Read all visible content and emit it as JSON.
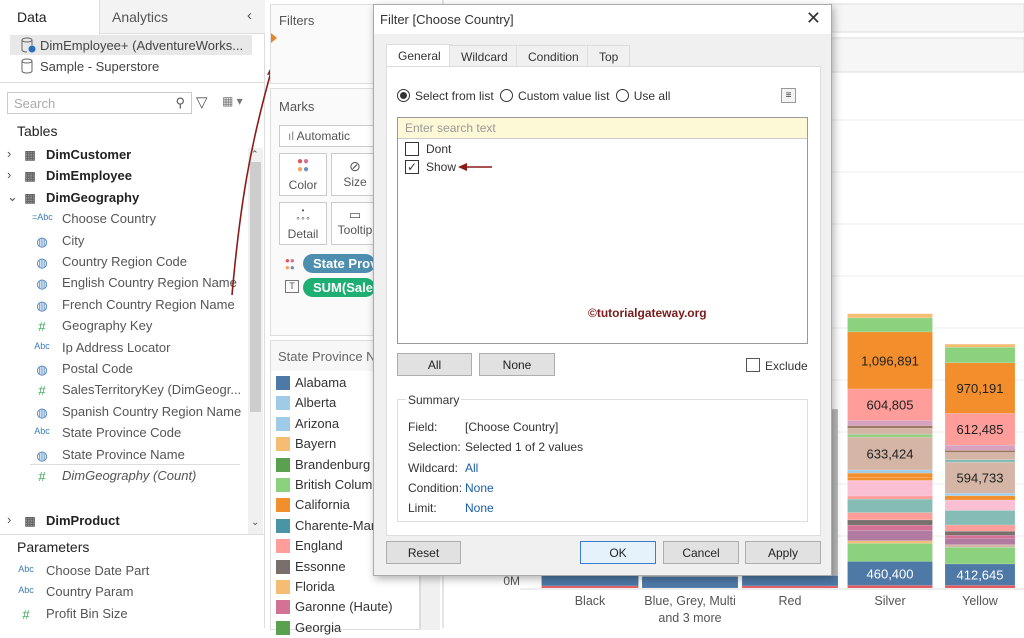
{
  "left_panel": {
    "tabs": [
      "Data",
      "Analytics"
    ],
    "data_sources": [
      "DimEmployee+ (AdventureWorks...",
      "Sample - Superstore"
    ],
    "search_placeholder": "Search",
    "tables_heading": "Tables",
    "tree": [
      {
        "type": "table",
        "label": "DimCustomer",
        "expanded": false
      },
      {
        "type": "table",
        "label": "DimEmployee",
        "expanded": false
      },
      {
        "type": "table",
        "label": "DimGeography",
        "expanded": true
      },
      {
        "type": "field",
        "icon": "=Abc",
        "label": "Choose Country"
      },
      {
        "type": "field",
        "icon": "globe",
        "label": "City"
      },
      {
        "type": "field",
        "icon": "globe",
        "label": "Country Region Code"
      },
      {
        "type": "field",
        "icon": "globe",
        "label": "English Country Region Name"
      },
      {
        "type": "field",
        "icon": "globe",
        "label": "French Country Region Name"
      },
      {
        "type": "field",
        "icon": "#",
        "label": "Geography Key"
      },
      {
        "type": "field",
        "icon": "Abc",
        "label": "Ip Address Locator"
      },
      {
        "type": "field",
        "icon": "globe",
        "label": "Postal Code"
      },
      {
        "type": "field",
        "icon": "#",
        "label": "SalesTerritoryKey (DimGeogr..."
      },
      {
        "type": "field",
        "icon": "globe",
        "label": "Spanish Country Region Name"
      },
      {
        "type": "field",
        "icon": "Abc",
        "label": "State Province Code"
      },
      {
        "type": "field",
        "icon": "globe",
        "label": "State Province Name"
      },
      {
        "type": "measure",
        "icon": "#",
        "label": "DimGeography (Count)"
      },
      {
        "type": "table",
        "label": "DimProduct",
        "expanded": false
      }
    ],
    "parameters_heading": "Parameters",
    "parameters": [
      {
        "icon": "Abc",
        "label": "Choose Date Part"
      },
      {
        "icon": "Abc",
        "label": "Country Param"
      },
      {
        "icon": "#",
        "label": "Profit Bin Size"
      }
    ]
  },
  "shelves": {
    "filters_title": "Filters",
    "marks_title": "Marks",
    "mark_type": "Automatic",
    "cards": [
      "Color",
      "Size",
      "Detail",
      "Tooltip"
    ],
    "pills": [
      {
        "label": "State Province Name",
        "color": "#4e8faf"
      },
      {
        "label": "SUM(Sales Amount)",
        "color": "#1fae74"
      }
    ]
  },
  "legend": {
    "title": "State Province Name",
    "items": [
      {
        "label": "Alabama",
        "color": "#4e79a7"
      },
      {
        "label": "Alberta",
        "color": "#a0cbe8"
      },
      {
        "label": "Arizona",
        "color": "#a0cbe8"
      },
      {
        "label": "Bayern",
        "color": "#f5bd74"
      },
      {
        "label": "Brandenburg",
        "color": "#59a14f"
      },
      {
        "label": "British Columbia",
        "color": "#8cd17d"
      },
      {
        "label": "California",
        "color": "#f28e2b"
      },
      {
        "label": "Charente-Maritime",
        "color": "#4a94a8"
      },
      {
        "label": "England",
        "color": "#ff9d9a"
      },
      {
        "label": "Essonne",
        "color": "#79706e"
      },
      {
        "label": "Florida",
        "color": "#f5bd74"
      },
      {
        "label": "Garonne (Haute)",
        "color": "#d37295"
      },
      {
        "label": "Georgia",
        "color": "#59a14f"
      }
    ]
  },
  "dialog": {
    "title": "Filter [Choose Country]",
    "tabs": [
      "General",
      "Wildcard",
      "Condition",
      "Top"
    ],
    "radio_options": [
      {
        "label": "Select from list",
        "selected": true
      },
      {
        "label": "Custom value list",
        "selected": false
      },
      {
        "label": "Use all",
        "selected": false
      }
    ],
    "search_placeholder": "Enter search text",
    "values": [
      {
        "label": "Dont",
        "checked": false
      },
      {
        "label": "Show",
        "checked": true
      }
    ],
    "watermark": "©tutorialgateway.org",
    "all_label": "All",
    "none_label": "None",
    "exclude_label": "Exclude",
    "summary": {
      "heading": "Summary",
      "rows": [
        {
          "label": "Field:",
          "value": "[Choose Country]"
        },
        {
          "label": "Selection:",
          "value": "Selected 1 of 2 values"
        },
        {
          "label": "Wildcard:",
          "value": "All"
        },
        {
          "label": "Condition:",
          "value": "None"
        },
        {
          "label": "Limit:",
          "value": "None"
        }
      ]
    },
    "buttons": {
      "reset": "Reset",
      "ok": "OK",
      "cancel": "Cancel",
      "apply": "Apply"
    }
  },
  "chart_data": {
    "type": "bar",
    "stacked": true,
    "categories": [
      "Black",
      "Blue, Grey, Multi and 3 more",
      "Red",
      "Silver",
      "Yellow"
    ],
    "y_tick_visible": "0M",
    "ylim": [
      0,
      5.3
    ],
    "series_labels": {
      "Silver": {
        "Alabama": "460,400",
        "Charente-Maritime": "633,424",
        "England": "604,805",
        "California": "1,096,891"
      },
      "Yellow": {
        "Alabama": "412,645",
        "Charente-Maritime": "594,733",
        "England": "612,485",
        "California": "970,191"
      }
    },
    "bars": [
      {
        "category": "Black",
        "segments": [
          [
            0.04,
            "#e15759"
          ],
          [
            0.2,
            "#4e79a7"
          ],
          [
            4.0,
            "#bbbbbb"
          ]
        ]
      },
      {
        "category": "Blue, Grey, Multi and 3 more",
        "segments": [
          [
            0.22,
            "#4e79a7"
          ],
          [
            3.5,
            "#bbbbbb"
          ]
        ]
      },
      {
        "category": "Red",
        "segments": [
          [
            0.04,
            "#e15759"
          ],
          [
            0.2,
            "#4e79a7"
          ],
          [
            3.2,
            "#bbbbbb"
          ]
        ]
      },
      {
        "category": "Silver",
        "segments": [
          [
            0.05,
            "#e15759"
          ],
          [
            0.46,
            "#4e79a7",
            "460,400"
          ],
          [
            0.35,
            "#8cd17d"
          ],
          [
            0.05,
            "#f5bd74"
          ],
          [
            0.2,
            "#b07aa1"
          ],
          [
            0.1,
            "#d37295"
          ],
          [
            0.1,
            "#79706e"
          ],
          [
            0.14,
            "#ff9d9a"
          ],
          [
            0.26,
            "#86bcb6"
          ],
          [
            0.06,
            "#ff9d9a"
          ],
          [
            0.3,
            "#fabfd2"
          ],
          [
            0.06,
            "#f28e2b"
          ],
          [
            0.08,
            "#f28e2b"
          ],
          [
            0.06,
            "#a0cbe8"
          ],
          [
            0.633,
            "#d4b5a6",
            "633,424"
          ],
          [
            0.05,
            "#8cd17d"
          ],
          [
            0.12,
            "#d4b5a6"
          ],
          [
            0.05,
            "#9d7660"
          ],
          [
            0.1,
            "#d7a2c0"
          ],
          [
            0.605,
            "#ff9d9a",
            "604,805"
          ],
          [
            1.097,
            "#f28e2b",
            "1,096,891"
          ],
          [
            0.27,
            "#8cd17d"
          ],
          [
            0.08,
            "#f5bd74"
          ]
        ]
      },
      {
        "category": "Yellow",
        "segments": [
          [
            0.05,
            "#e15759"
          ],
          [
            0.413,
            "#4e79a7",
            "412,645"
          ],
          [
            0.32,
            "#8cd17d"
          ],
          [
            0.05,
            "#d4b5a6"
          ],
          [
            0.12,
            "#b07aa1"
          ],
          [
            0.06,
            "#d37295"
          ],
          [
            0.08,
            "#79706e"
          ],
          [
            0.12,
            "#ff9d9a"
          ],
          [
            0.28,
            "#86bcb6"
          ],
          [
            0.2,
            "#fabfd2"
          ],
          [
            0.08,
            "#f28e2b"
          ],
          [
            0.05,
            "#a0cbe8"
          ],
          [
            0.595,
            "#d4b5a6",
            "594,733"
          ],
          [
            0.05,
            "#86bcb6"
          ],
          [
            0.14,
            "#d4b5a6"
          ],
          [
            0.04,
            "#9d7660"
          ],
          [
            0.1,
            "#d7a2c0"
          ],
          [
            0.612,
            "#ff9d9a",
            "612,485"
          ],
          [
            0.97,
            "#f28e2b",
            "970,191"
          ],
          [
            0.3,
            "#8cd17d"
          ],
          [
            0.06,
            "#f5bd74"
          ]
        ]
      }
    ]
  }
}
